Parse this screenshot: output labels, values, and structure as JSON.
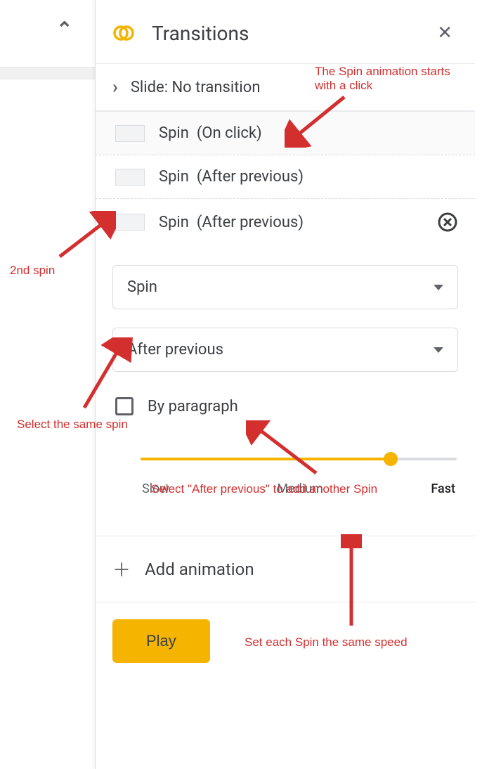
{
  "header": {
    "title": "Transitions"
  },
  "slide_row": {
    "label": "Slide: No transition"
  },
  "animations": [
    {
      "name": "Spin",
      "trigger": "(On click)"
    },
    {
      "name": "Spin",
      "trigger": "(After previous)"
    },
    {
      "name": "Spin",
      "trigger": "(After previous)"
    }
  ],
  "editor": {
    "type_dropdown": "Spin",
    "trigger_dropdown": "After previous",
    "by_paragraph_label": "By paragraph",
    "speed": {
      "slow": "Slow",
      "medium": "Medium",
      "fast": "Fast",
      "value_pct": 79
    }
  },
  "add_animation_label": "Add animation",
  "play_label": "Play",
  "annotations": {
    "a1": "The Spin animation starts with a click",
    "a2": "2nd spin",
    "a3": "Select the same spin",
    "a4": "Select \"After previous\" to add another Spin",
    "a5": "Set each Spin the same speed"
  }
}
